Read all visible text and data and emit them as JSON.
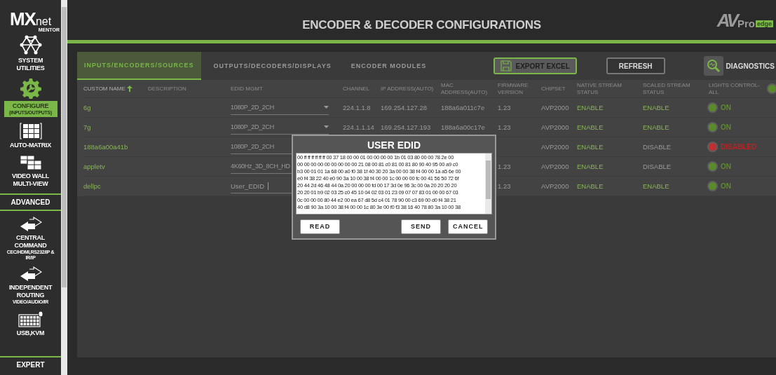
{
  "sidebar": {
    "logo": {
      "main": "MX",
      "suffix": "net",
      "sub": "MENTOR"
    },
    "items": [
      {
        "kind": "network",
        "label": "SYSTEM UTILITIES",
        "selected": false
      },
      {
        "kind": "gear",
        "label": "CONFIGURE",
        "sublabel": "(INPUTS/OUTPUTS)",
        "selected": true
      },
      {
        "kind": "matrix",
        "label": "AUTO-MATRIX",
        "selected": false
      },
      {
        "kind": "wall",
        "label": "VIDEO WALL MULTI-VIEW",
        "selected": false
      },
      {
        "kind": "section",
        "label": "ADVANCED",
        "selected": false
      },
      {
        "kind": "arrows",
        "label": "CENTRAL COMMAND",
        "sublabel": "CEC/HDMI,RS232/IP & IR/IP",
        "selected": false
      },
      {
        "kind": "arrows",
        "label": "INDEPENDENT ROUTING",
        "sublabel": "VIDEO/AUDIO/IR",
        "selected": false
      },
      {
        "kind": "keyboard",
        "label": "USB,KVM",
        "selected": false
      },
      {
        "kind": "section",
        "label": "EXPERT",
        "selected": false
      }
    ]
  },
  "header": {
    "title": "ENCODER & DECODER CONFIGURATIONS",
    "brand": {
      "mark": "AV",
      "name": "Pro",
      "tag": "edge"
    }
  },
  "tabs": [
    {
      "label": "INPUTS/ENCODERS/SOURCES",
      "selected": true
    },
    {
      "label": "OUTPUTS/DECODERS/DISPLAYS",
      "selected": false
    },
    {
      "label": "ENCODER MODULES",
      "selected": false
    }
  ],
  "toolbar": {
    "export": "EXPORT EXCEL",
    "refresh": "REFRESH",
    "diagnostics": "DIAGNOSTICS"
  },
  "table": {
    "columns": [
      {
        "label": "CUSTOM NAME",
        "sorted": true
      },
      {
        "label": "DESCRIPTION",
        "sorted": false
      },
      {
        "label": "EDID MGMT",
        "sorted": false
      },
      {
        "label": "CHANNEL",
        "sorted": false
      },
      {
        "label": "IP ADDRESS(AUTO)",
        "sorted": false
      },
      {
        "label": "MAC ADDRESS(AUTO)",
        "sorted": false
      },
      {
        "label": "FIRMWARE VERSION",
        "sorted": false
      },
      {
        "label": "CHIPSET",
        "sorted": false
      },
      {
        "label": "NATIVE STREAM STATUS",
        "sorted": false
      },
      {
        "label": "SCALED STREAM STATUS",
        "sorted": false
      },
      {
        "label": "LIGHTS CONTROL-ALL",
        "sorted": false
      }
    ],
    "lights_all_on": true,
    "rows": [
      {
        "name": "6g",
        "edid": "1080P_2D_2CH",
        "kind": "select",
        "channel": "224.1.1.8",
        "ip": "169.254.127.28",
        "mac": "188a6a011c7e",
        "firmware": "1.23",
        "chipset": "AVP2000",
        "native": "ENABLE",
        "native_enabled": true,
        "scaled": "ENABLE",
        "scaled_enabled": true,
        "lights_on": true,
        "lights": "ON"
      },
      {
        "name": "7g",
        "edid": "1080P_2D_2CH",
        "kind": "select",
        "channel": "224.1.1.14",
        "ip": "169.254.127.193",
        "mac": "188a6a00c17e",
        "firmware": "1.23",
        "chipset": "AVP2000",
        "native": "ENABLE",
        "native_enabled": true,
        "scaled": "ENABLE",
        "scaled_enabled": true,
        "lights_on": true,
        "lights": "ON"
      },
      {
        "name": "188a6a00a41b",
        "edid": "1080P_2D_2CH",
        "kind": "select",
        "chipset": "AVP2000",
        "native": "ENABLE",
        "native_enabled": true,
        "scaled": "DISABLE",
        "scaled_enabled": false,
        "lights_on": false,
        "lights": "DISABLED"
      },
      {
        "name": "appletv",
        "edid": "4K60Hz_3D_8CH_HD",
        "kind": "select",
        "firmware": "1.23",
        "chipset": "AVP2000",
        "native": "ENABLE",
        "native_enabled": true,
        "scaled": "DISABLE",
        "scaled_enabled": false,
        "lights_on": true,
        "lights": "ON"
      },
      {
        "name": "dellpc",
        "edid": "User_EDID",
        "kind": "text",
        "firmware": "1.23",
        "chipset": "AVP2000",
        "native": "ENABLE",
        "native_enabled": true,
        "scaled": "ENABLE",
        "scaled_enabled": true,
        "lights_on": true,
        "lights": "ON"
      }
    ]
  },
  "dialog": {
    "title": "USER EDID",
    "hex_lines": [
      "00 ff ff ff ff ff ff 00 37 18 00 00 01 00 00 00 00 1b 01 03 80 00 00 78 2e 00",
      "00 00 00 00 00 00 00 00 00 21 08 00 81 c0 81 00 81 80 90 40 95 00 a9 c0",
      "b3 00 01 01 1a 68 00 a0 f0 38 1f 40 30 20 3a 00 00 38 f4 00 00 1a a5 6e 00",
      "e0 f4 38 22 40 e0 90 3a 10 00 38 f4 00 00 1c 00 00 00 fc 00 41 56 50 72 6f",
      "20 44 2d 46 48 44 0a 20 00 00 00 fd 00 17 3d 0e 96 3c 00 0a 20 20 20 20",
      "20 20 01 b9 02 03 25 c0 45 10 04 02 03 01 23 09 07 07 83 01 00 00 67 03",
      "0c 00 00 00 80 44 e2 00 ea 67 d8 5d c4 01 78 90 00 c3 69 00 d0 f4 38 21",
      "40 d8 90 3a 10 00 38 f4 00 00 1c 80 3e 00 f0 f3 38 16 40 78 80 3a 10 00 38"
    ],
    "buttons": [
      {
        "label": "READ"
      },
      {
        "label": "SEND"
      },
      {
        "label": "CANCEL"
      }
    ]
  }
}
